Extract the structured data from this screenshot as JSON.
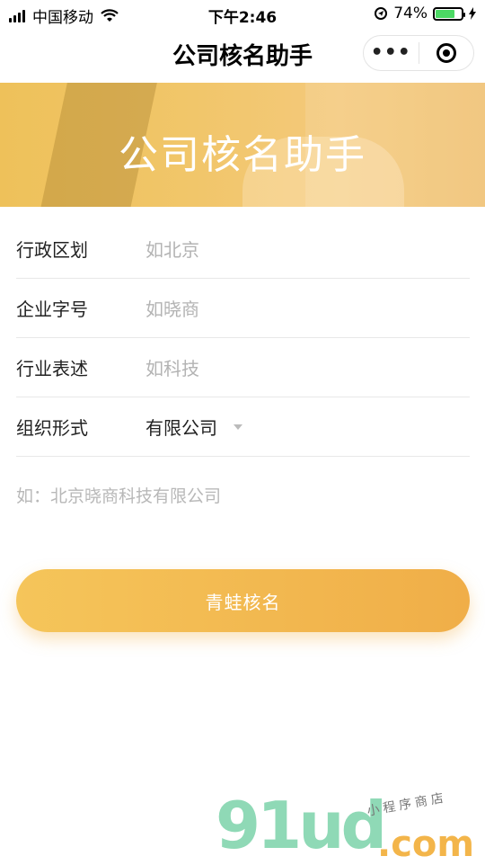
{
  "status_bar": {
    "carrier": "中国移动",
    "time": "下午2:46",
    "battery": "74%",
    "battery_level": 0.74,
    "icons": [
      "signal-icon",
      "wifi-icon",
      "location-icon",
      "battery-icon",
      "charging-icon"
    ]
  },
  "nav": {
    "title": "公司核名助手",
    "more_icon": "more-dots-icon",
    "close_icon": "target-close-icon"
  },
  "banner": {
    "title": "公司核名助手"
  },
  "form": {
    "region_label": "行政区划",
    "region_placeholder": "如北京",
    "brand_label": "企业字号",
    "brand_placeholder": "如晓商",
    "industry_label": "行业表述",
    "industry_placeholder": "如科技",
    "org_label": "组织形式",
    "org_value": "有限公司",
    "example": "如：北京晓商科技有限公司"
  },
  "button": {
    "label": "青蛙核名"
  },
  "watermark": {
    "brand": "91ud",
    "domain": ".com",
    "tagline": "小程序商店"
  },
  "colors": {
    "accent": "#f2b84f",
    "banner": "#f1c66a",
    "watermark_green": "#8fd9b6"
  }
}
